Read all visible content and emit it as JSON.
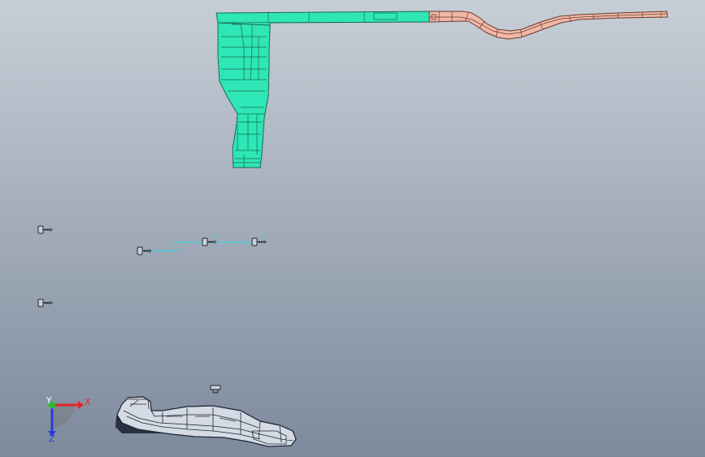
{
  "viewport": {
    "background_top": "#c7ced7",
    "background_bottom": "#7d8a9c"
  },
  "colors": {
    "bracket_fill": "#2ee6b6",
    "bracket_stroke": "#1a6a52",
    "rail_fill": "#f0b8a6",
    "rail_stroke": "#6b3a2e",
    "fastener_stroke": "#1e2430",
    "fastener_fill": "#c9d0d8",
    "constraint_line": "#27d7e6",
    "lower_part_fill": "#d5dbe4",
    "lower_part_stroke": "#1c2230",
    "lower_part_shadow": "#2b3140"
  },
  "triad": {
    "x_label": "X",
    "y_label": "Y",
    "z_label": "Z",
    "x_color": "#e0262a",
    "y_color": "#2dbb2d",
    "z_color": "#2a3ad6",
    "icon": "coordinate-triad-icon"
  },
  "model": {
    "components": [
      {
        "name": "bracket",
        "icon": "bracket-icon"
      },
      {
        "name": "rail",
        "icon": "rail-icon"
      },
      {
        "name": "fasteners",
        "icon": "bolt-icon"
      },
      {
        "name": "lower-part",
        "icon": "panel-icon"
      }
    ]
  }
}
